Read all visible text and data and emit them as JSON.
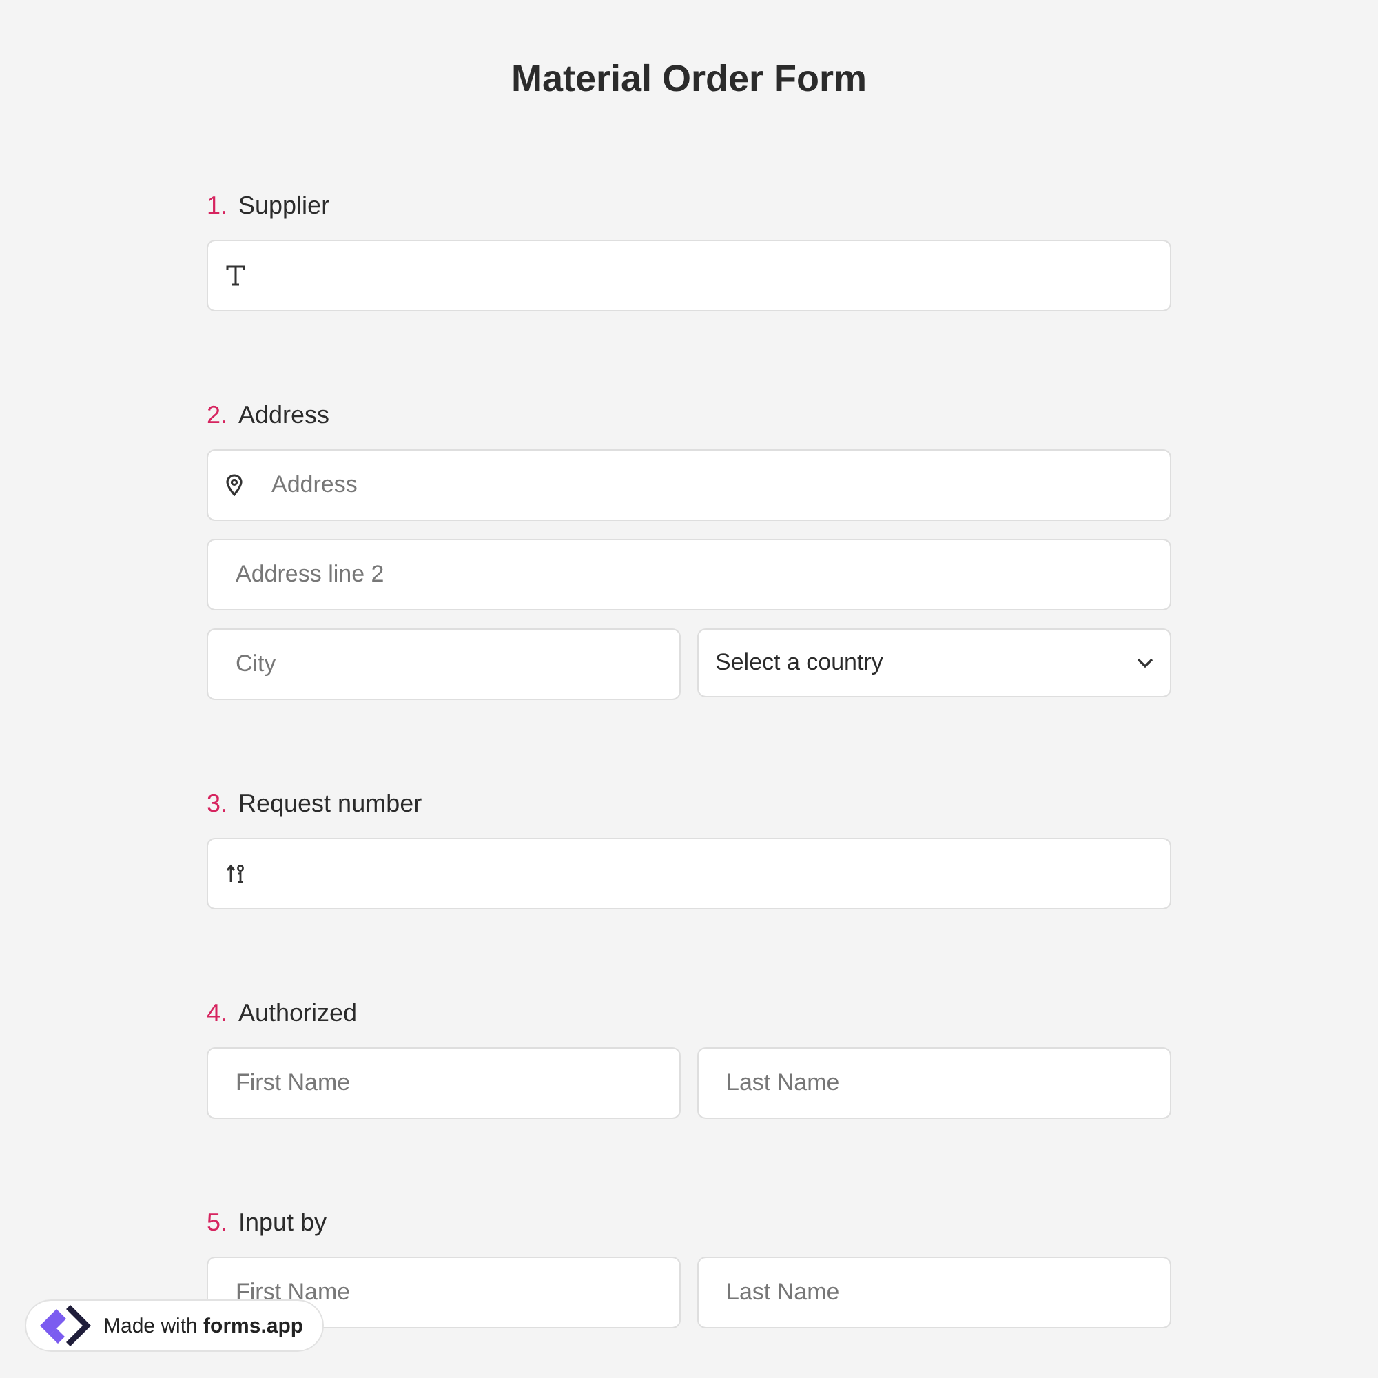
{
  "title": "Material Order Form",
  "questions": [
    {
      "number": "1.",
      "label": "Supplier",
      "rows": [
        [
          {
            "kind": "text"
          }
        ]
      ]
    },
    {
      "number": "2.",
      "label": "Address",
      "rows": [
        [
          {
            "kind": "address",
            "placeholder": "Address"
          }
        ],
        [
          {
            "kind": "plain",
            "placeholder": "Address line 2"
          }
        ],
        [
          {
            "kind": "plain",
            "placeholder": "City"
          },
          {
            "kind": "select",
            "value": "Select a country"
          }
        ]
      ]
    },
    {
      "number": "3.",
      "label": "Request number",
      "rows": [
        [
          {
            "kind": "number"
          }
        ]
      ]
    },
    {
      "number": "4.",
      "label": "Authorized",
      "rows": [
        [
          {
            "kind": "plain",
            "placeholder": "First Name"
          },
          {
            "kind": "plain",
            "placeholder": "Last Name"
          }
        ]
      ]
    },
    {
      "number": "5.",
      "label": "Input by",
      "rows": [
        [
          {
            "kind": "plain",
            "placeholder": "First Name"
          },
          {
            "kind": "plain",
            "placeholder": "Last Name"
          }
        ]
      ]
    }
  ],
  "badge": {
    "text": "Made with **forms.app**"
  }
}
